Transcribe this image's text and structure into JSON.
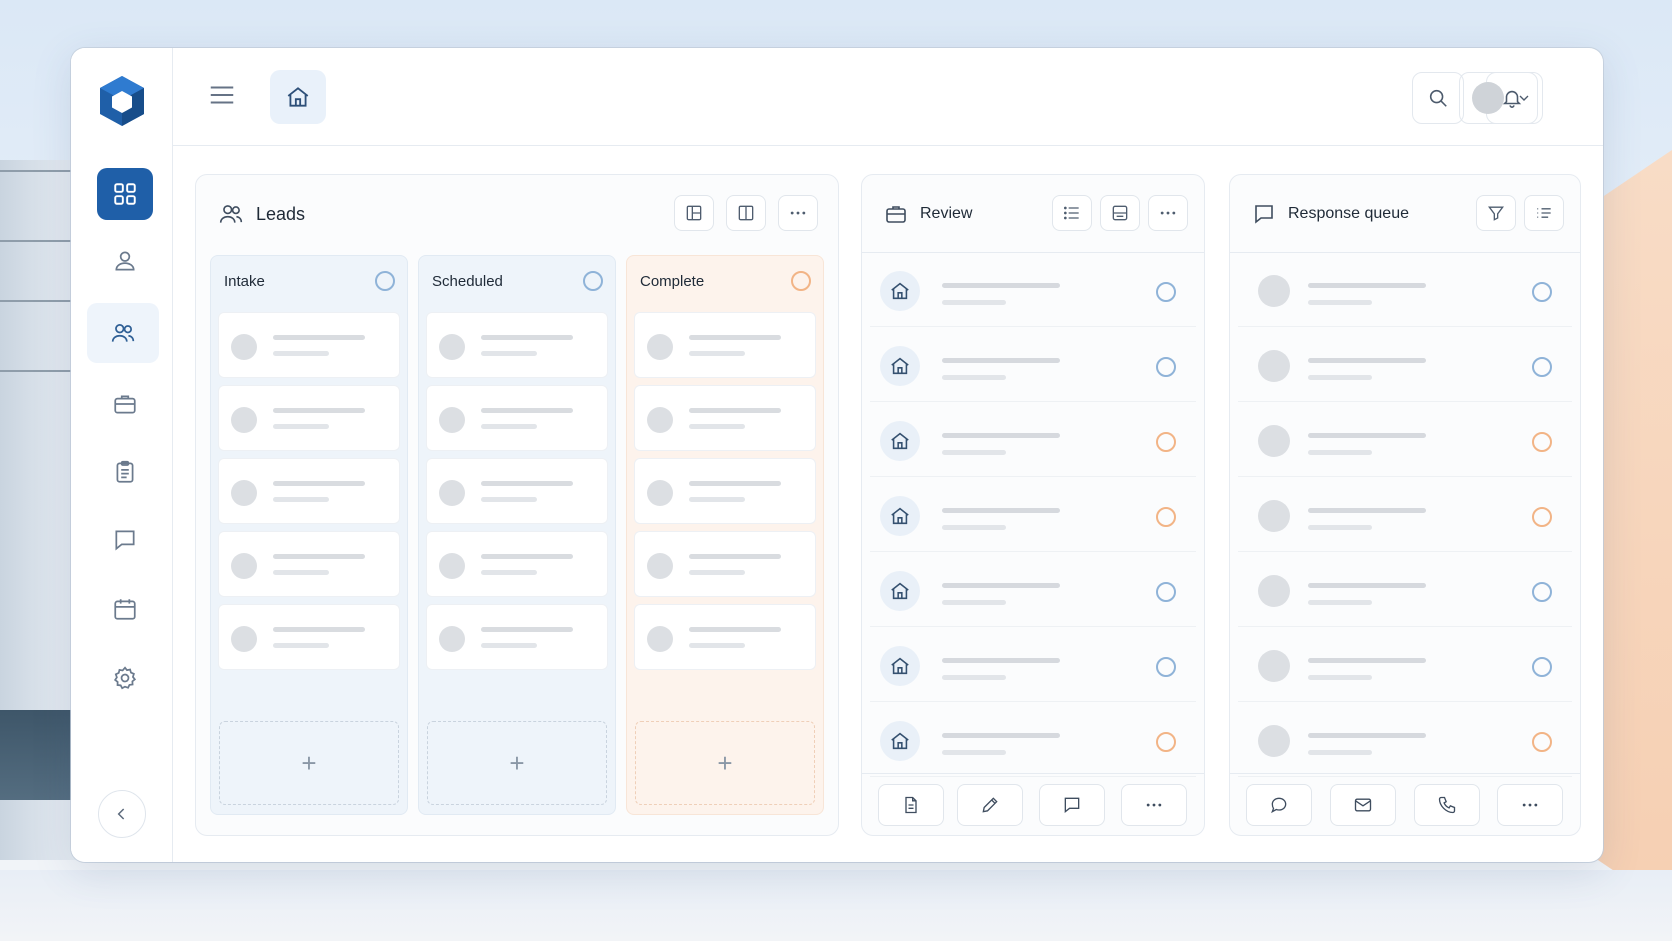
{
  "colors": {
    "brand": "#1f5fa8",
    "accent_blue_ring": "#8fb3d8",
    "accent_orange_ring": "#f2b486",
    "peach_column": "#fdf3ec"
  },
  "sidebar": {
    "items": [
      {
        "icon": "dashboard-grid-icon",
        "active": true
      },
      {
        "icon": "user-icon"
      },
      {
        "icon": "users-icon",
        "selected": true
      },
      {
        "icon": "briefcase-icon"
      },
      {
        "icon": "clipboard-icon"
      },
      {
        "icon": "chat-icon"
      },
      {
        "icon": "calendar-icon"
      },
      {
        "icon": "gear-icon"
      }
    ],
    "collapse_icon": "chevron-left-icon"
  },
  "topbar": {
    "menu_icon": "hamburger-icon",
    "home_icon": "home-icon",
    "search_icon": "search-icon",
    "bell_icon": "bell-icon",
    "profile_chevron_icon": "chevron-down-icon"
  },
  "leads": {
    "title": "Leads",
    "columns": [
      {
        "label": "Intake",
        "add": "+"
      },
      {
        "label": "Scheduled",
        "add": "+"
      },
      {
        "label": "Complete",
        "add": "+"
      }
    ]
  },
  "review": {
    "title": "Review",
    "row_status": [
      "blue",
      "blue",
      "orange",
      "orange",
      "blue",
      "blue",
      "orange"
    ],
    "footer_icons": [
      "document-icon",
      "pencil-icon",
      "comment-icon",
      "more-icon"
    ]
  },
  "response_queue": {
    "title": "Response queue",
    "row_status": [
      "blue",
      "blue",
      "orange",
      "orange",
      "blue",
      "blue",
      "orange"
    ],
    "footer_icons": [
      "speech-bubble-icon",
      "mail-icon",
      "phone-icon",
      "more-icon"
    ]
  }
}
